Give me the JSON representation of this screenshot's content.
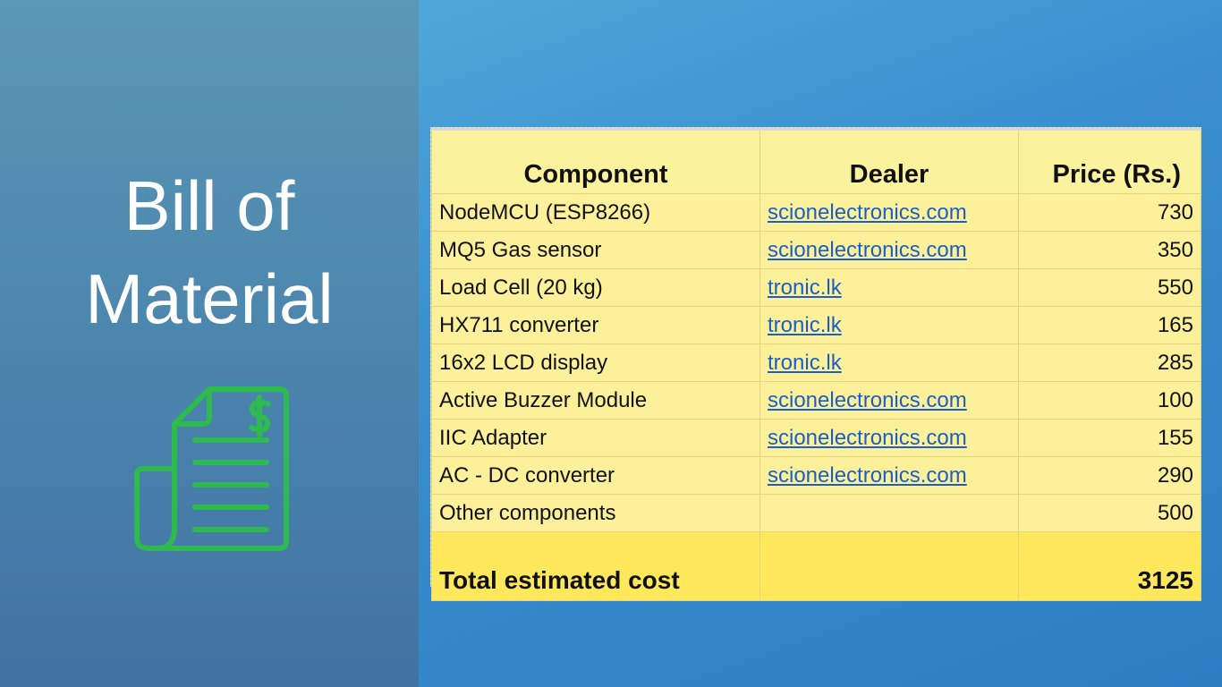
{
  "slide": {
    "title_line1": "Bill of",
    "title_line2": "Material",
    "icon": "bill-dollar-icon",
    "icon_color": "#2dba4e"
  },
  "table": {
    "headers": {
      "component": "Component",
      "dealer": "Dealer",
      "price": "Price (Rs.)"
    },
    "rows": [
      {
        "component": "NodeMCU (ESP8266)",
        "dealer": "scionelectronics.com",
        "price": "730"
      },
      {
        "component": "MQ5 Gas sensor",
        "dealer": "scionelectronics.com",
        "price": "350"
      },
      {
        "component": "Load Cell (20 kg)",
        "dealer": "tronic.lk",
        "price": "550"
      },
      {
        "component": "HX711 converter",
        "dealer": "tronic.lk",
        "price": "165"
      },
      {
        "component": "16x2 LCD display",
        "dealer": "tronic.lk",
        "price": "285"
      },
      {
        "component": "Active Buzzer Module",
        "dealer": "scionelectronics.com",
        "price": "100"
      },
      {
        "component": "IIC Adapter",
        "dealer": "scionelectronics.com",
        "price": "155"
      },
      {
        "component": "AC - DC converter",
        "dealer": "scionelectronics.com",
        "price": "290"
      },
      {
        "component": "Other components",
        "dealer": "",
        "price": "500"
      }
    ],
    "total": {
      "label": "Total estimated cost",
      "dealer": "",
      "price": "3125"
    }
  },
  "colors": {
    "table_fill": "#fdf09a",
    "total_fill": "#ffe85c",
    "link": "#1a5fc8"
  }
}
